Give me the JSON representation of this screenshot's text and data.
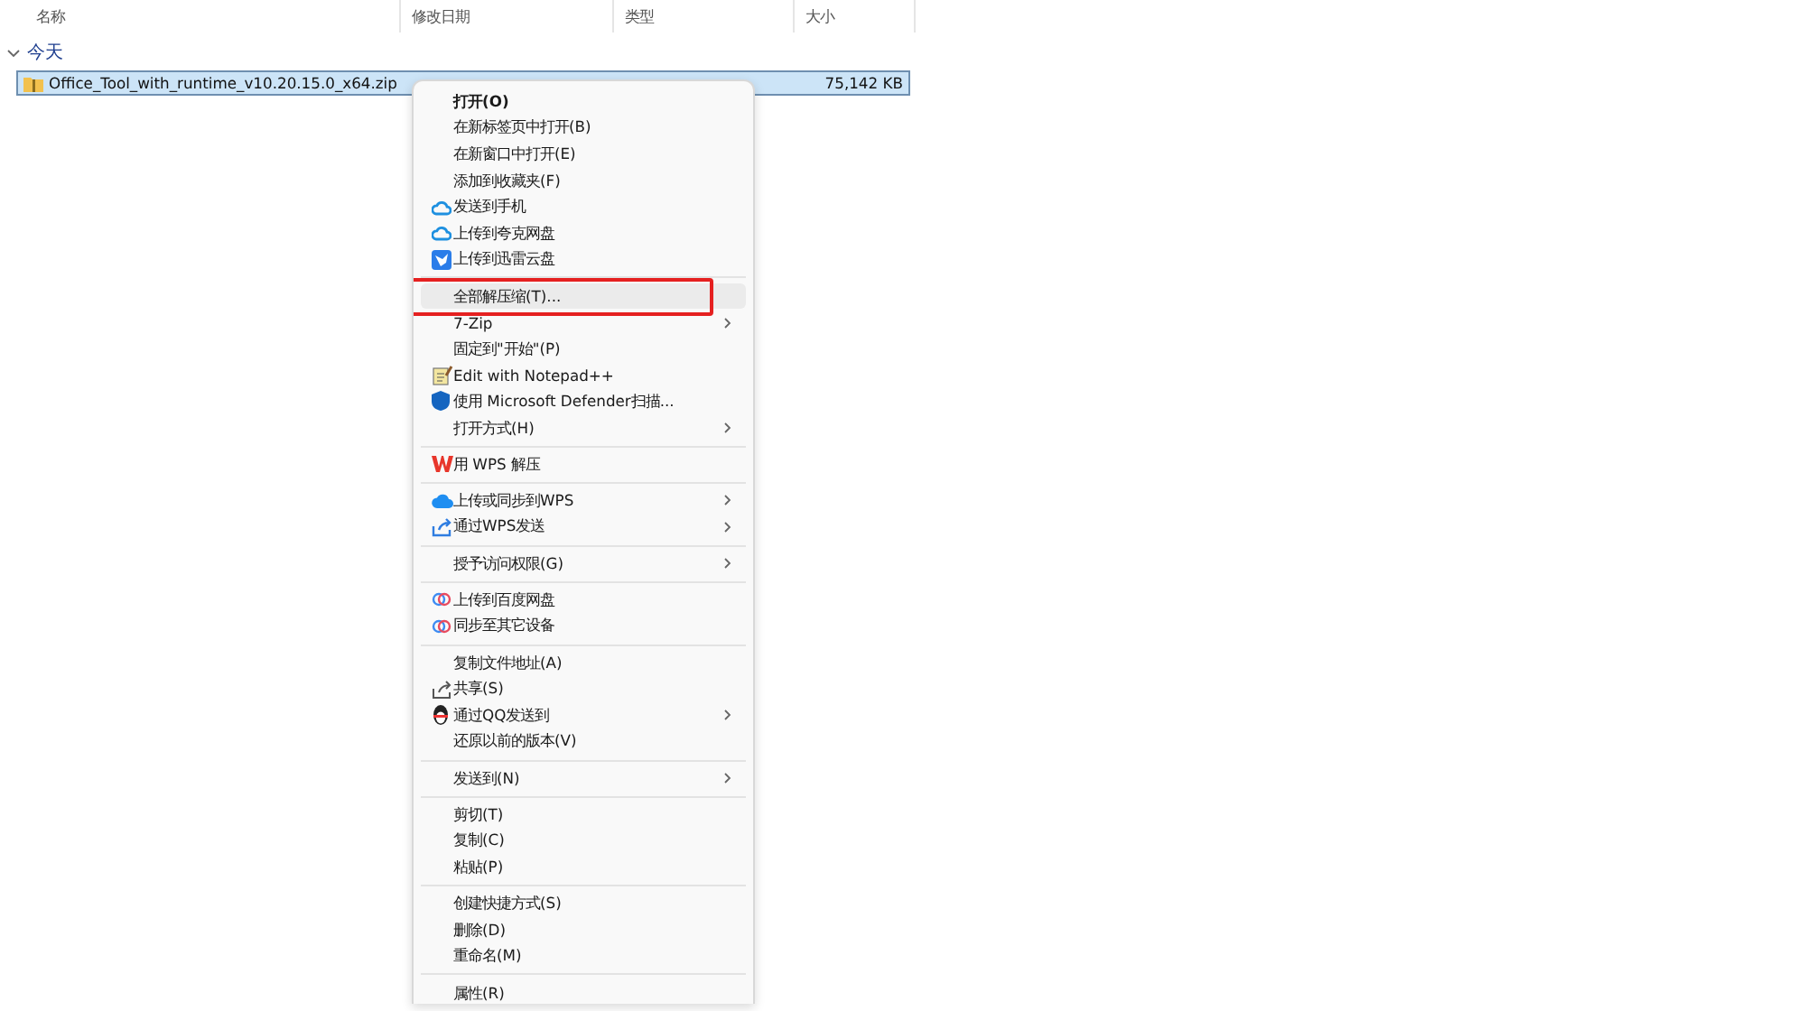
{
  "columns": [
    {
      "label": "名称"
    },
    {
      "label": "修改日期"
    },
    {
      "label": "类型"
    },
    {
      "label": "大小"
    }
  ],
  "group": {
    "label": "今天",
    "expanded": true
  },
  "files": [
    {
      "name": "Office_Tool_with_runtime_v10.20.15.0_x64.zip",
      "size": "75,142 KB",
      "selected": true
    }
  ],
  "menu": [
    {
      "kind": "item",
      "label": "打开(O)",
      "default": true
    },
    {
      "kind": "item",
      "label": "在新标签页中打开(B)"
    },
    {
      "kind": "item",
      "label": "在新窗口中打开(E)"
    },
    {
      "kind": "item",
      "label": "添加到收藏夹(F)"
    },
    {
      "kind": "item",
      "label": "发送到手机"
    },
    {
      "kind": "item",
      "label": "上传到夸克网盘"
    },
    {
      "kind": "item",
      "label": "上传到迅雷云盘"
    },
    {
      "kind": "separator"
    },
    {
      "kind": "item",
      "label": "全部解压缩(T)...",
      "highlighted": true,
      "annotated": true
    },
    {
      "kind": "item",
      "label": "7-Zip",
      "submenu": true
    },
    {
      "kind": "item",
      "label": "固定到\"开始\"(P)"
    },
    {
      "kind": "item",
      "label": "Edit with Notepad++"
    },
    {
      "kind": "item",
      "label": "使用 Microsoft Defender扫描..."
    },
    {
      "kind": "item",
      "label": "打开方式(H)",
      "submenu": true
    },
    {
      "kind": "separator"
    },
    {
      "kind": "item",
      "label": "用 WPS 解压"
    },
    {
      "kind": "separator"
    },
    {
      "kind": "item",
      "label": "上传或同步到WPS",
      "submenu": true
    },
    {
      "kind": "item",
      "label": "通过WPS发送",
      "submenu": true
    },
    {
      "kind": "separator"
    },
    {
      "kind": "item",
      "label": "授予访问权限(G)",
      "submenu": true
    },
    {
      "kind": "separator"
    },
    {
      "kind": "item",
      "label": "上传到百度网盘"
    },
    {
      "kind": "item",
      "label": "同步至其它设备"
    },
    {
      "kind": "separator"
    },
    {
      "kind": "item",
      "label": "复制文件地址(A)"
    },
    {
      "kind": "item",
      "label": "共享(S)"
    },
    {
      "kind": "item",
      "label": "通过QQ发送到",
      "submenu": true
    },
    {
      "kind": "item",
      "label": "还原以前的版本(V)"
    },
    {
      "kind": "separator"
    },
    {
      "kind": "item",
      "label": "发送到(N)",
      "submenu": true
    },
    {
      "kind": "separator"
    },
    {
      "kind": "item",
      "label": "剪切(T)"
    },
    {
      "kind": "item",
      "label": "复制(C)"
    },
    {
      "kind": "item",
      "label": "粘贴(P)"
    },
    {
      "kind": "separator"
    },
    {
      "kind": "item",
      "label": "创建快捷方式(S)"
    },
    {
      "kind": "item",
      "label": "删除(D)"
    },
    {
      "kind": "item",
      "label": "重命名(M)"
    },
    {
      "kind": "separator"
    },
    {
      "kind": "item",
      "label": "属性(R)"
    }
  ]
}
